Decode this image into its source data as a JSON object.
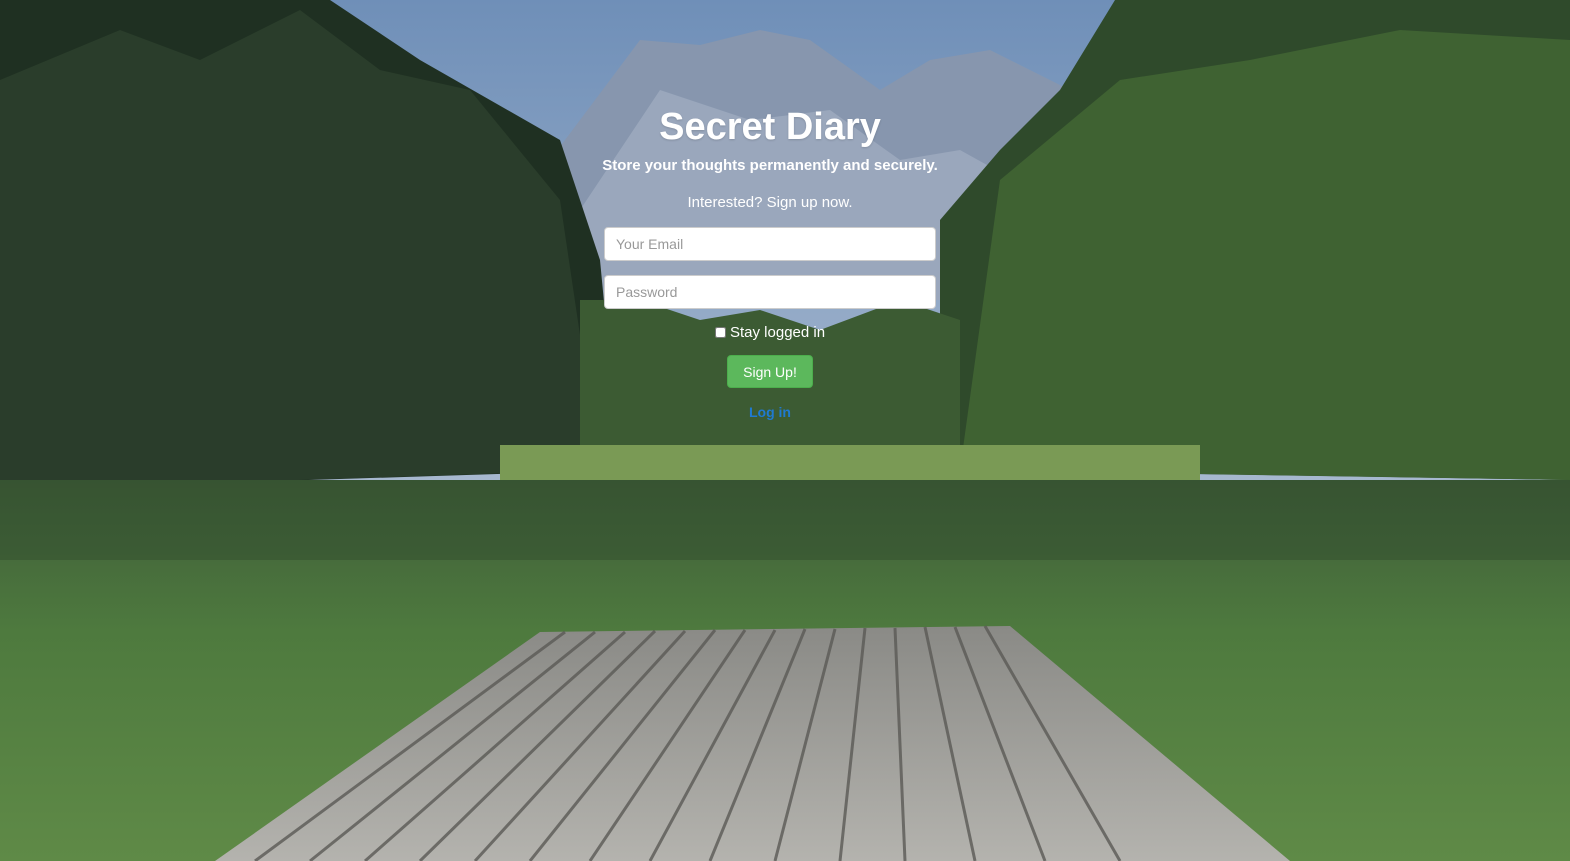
{
  "header": {
    "title": "Secret Diary",
    "subtitle": "Store your thoughts permanently and securely.",
    "tagline": "Interested? Sign up now."
  },
  "form": {
    "email_placeholder": "Your Email",
    "password_placeholder": "Password",
    "remember_label": "Stay logged in",
    "remember_checked": false,
    "submit_label": "Sign Up!",
    "toggle_link": "Log in"
  },
  "colors": {
    "button_green": "#5cb85c",
    "link_blue": "#1f7ad1"
  }
}
